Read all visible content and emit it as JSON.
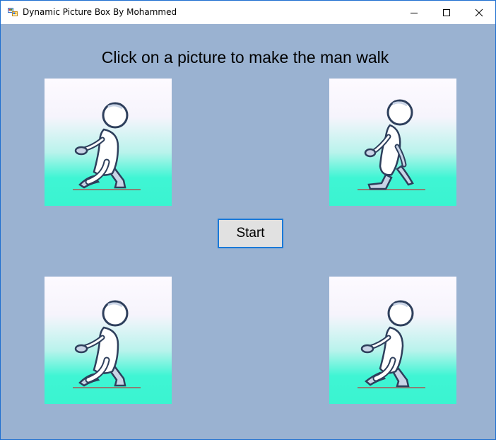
{
  "window": {
    "title": "Dynamic Picture Box By Mohammed",
    "accent_color": "#1e6fd0",
    "background_color": "#9ab2d1"
  },
  "main": {
    "heading": "Click on a picture to make the man walk",
    "start_button_label": "Start",
    "pictures": [
      {
        "depicts": "walking man frame 1"
      },
      {
        "depicts": "walking man frame 2"
      },
      {
        "depicts": "walking man frame 3"
      },
      {
        "depicts": "walking man frame 4"
      }
    ]
  },
  "icons": {
    "app": "app-icon",
    "minimize": "minimize-icon",
    "maximize": "maximize-icon",
    "close": "close-icon"
  }
}
